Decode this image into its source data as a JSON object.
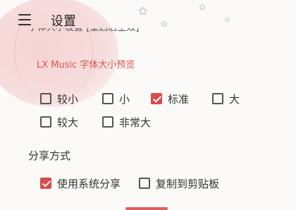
{
  "header": {
    "title": "设置",
    "menu_icon": "menu-icon",
    "partial_text": "字体大小设置 [重启后生效]"
  },
  "font_size": {
    "preview_text": "LX Music 字体大小预览",
    "options": [
      {
        "label": "较小",
        "checked": false
      },
      {
        "label": "小",
        "checked": false
      },
      {
        "label": "标准",
        "checked": true
      },
      {
        "label": "大",
        "checked": false
      },
      {
        "label": "较大",
        "checked": false
      },
      {
        "label": "非常大",
        "checked": false
      }
    ]
  },
  "share": {
    "title": "分享方式",
    "options": [
      {
        "label": "使用系统分享",
        "checked": true
      },
      {
        "label": "复制到剪贴板",
        "checked": false
      }
    ]
  },
  "colors": {
    "accent": "#d84c4c",
    "preview_text": "#d9534f",
    "background": "#fbfaf8"
  }
}
